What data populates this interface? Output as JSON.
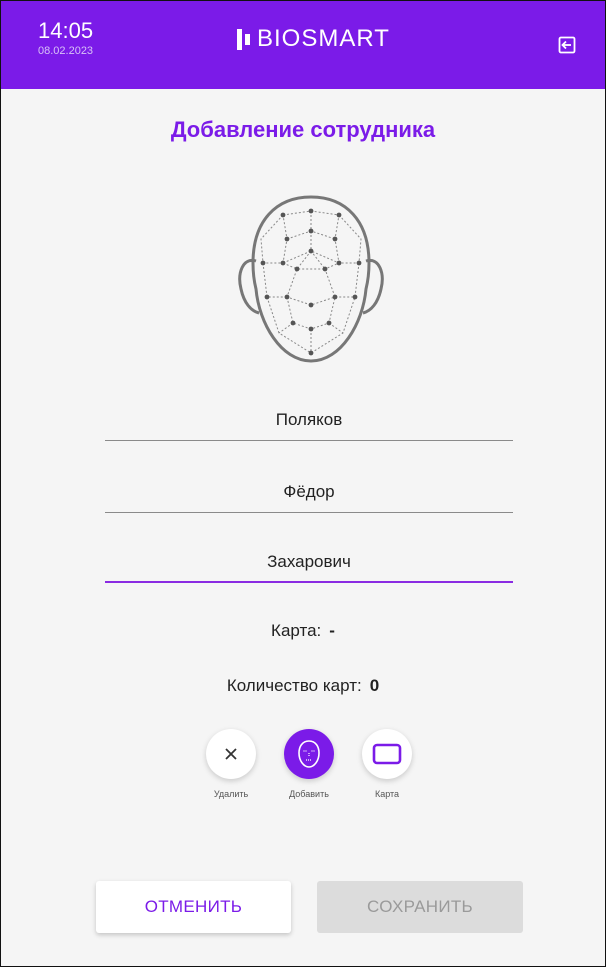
{
  "header": {
    "time": "14:05",
    "date": "08.02.2023",
    "brand": "BIOSMART",
    "bg_color": "#7b1be8"
  },
  "exit_icon": "exit-icon",
  "title": "Добавление сотрудника",
  "face_icon": "face-scan-icon",
  "fields": {
    "last_name": "Поляков",
    "first_name": "Фёдор",
    "middle_name": "Захарович"
  },
  "card": {
    "label": "Карта:",
    "value": "-"
  },
  "card_count": {
    "label": "Количество карт:",
    "value": "0"
  },
  "actions": {
    "delete": "Удалить",
    "add": "Добавить",
    "card": "Карта"
  },
  "buttons": {
    "cancel": "ОТМЕНИТЬ",
    "save": "СОХРАНИТЬ"
  }
}
